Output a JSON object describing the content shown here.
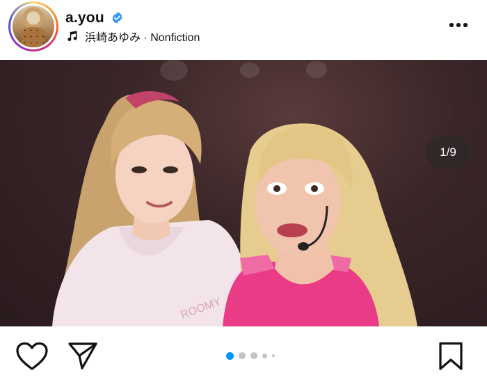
{
  "header": {
    "username": "a.you",
    "verified": true,
    "audio": "浜崎あゆみ · Nonfiction",
    "avatar_icon": "avatar",
    "music_icon": "music-note-icon",
    "more_icon": "more-horizontal-icon"
  },
  "media": {
    "counter": "1/9",
    "current_index": 1,
    "total": 9,
    "user_tag_icon": "person-icon",
    "mute_icon": "speaker-muted-icon"
  },
  "actions": {
    "like_icon": "heart-icon",
    "share_icon": "send-icon",
    "save_icon": "bookmark-icon"
  },
  "pagination": {
    "active_index": 0,
    "dot_count": 5,
    "active_color": "#0095f6",
    "inactive_color": "#c4c4c4"
  },
  "colors": {
    "verified_blue": "#3897f0",
    "text": "#111111"
  }
}
